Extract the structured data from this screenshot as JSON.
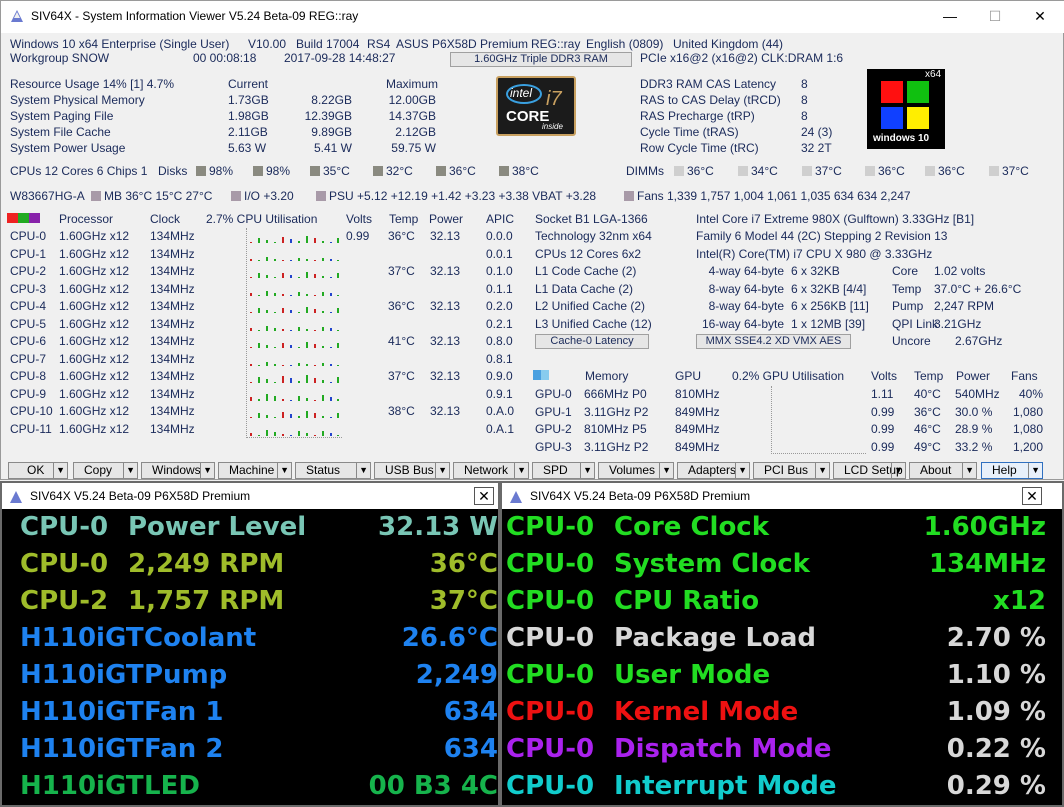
{
  "window": {
    "title": "SIV64X - System Information Viewer V5.24 Beta-09 REG::ray",
    "minimize": "—",
    "maximize": "☐",
    "close": "✕"
  },
  "header": {
    "line1": [
      "Windows 10 x64 Enterprise (Single User)",
      "V10.00",
      "Build 17004",
      "RS4",
      "ASUS P6X58D Premium",
      "REG::ray",
      "English (0809)",
      "United Kingdom (44)"
    ],
    "workgroup": "Workgroup SNOW",
    "uptime": "00 00:08:18",
    "datetime": "2017-09-28 14:48:27",
    "mem_button": "1.60GHz Triple DDR3 RAM",
    "pcie": "PCIe x16@2 (x16@2) CLK:DRAM 1:6"
  },
  "resources": {
    "header": "Resource Usage 14% [1] 4.7%",
    "current_label": "Current",
    "maximum_label": "Maximum",
    "rows": [
      {
        "label": "System Physical Memory",
        "current": "1.73GB",
        "avail": "8.22GB",
        "max": "12.00GB"
      },
      {
        "label": "System Paging File",
        "current": "1.98GB",
        "avail": "12.39GB",
        "max": "14.37GB"
      },
      {
        "label": "System File Cache",
        "current": "2.11GB",
        "avail": "9.89GB",
        "max": "2.12GB"
      },
      {
        "label": "System Power Usage",
        "current": "5.63 W",
        "avail": "5.41 W",
        "max": "59.75 W"
      }
    ]
  },
  "intel_logo": {
    "brand": "intel",
    "core": "CORE",
    "model": "i7",
    "inside": "inside"
  },
  "ram_timing": [
    {
      "label": "DDR3 RAM CAS Latency",
      "value": "8"
    },
    {
      "label": "RAS to CAS Delay (tRCD)",
      "value": "8"
    },
    {
      "label": "RAS Precharge (tRP)",
      "value": "8"
    },
    {
      "label": "Cycle Time (tRAS)",
      "value": "24 (3)"
    },
    {
      "label": "Row Cycle Time (tRC)",
      "value": "32 2T"
    }
  ],
  "win_logo": {
    "bits": "x64",
    "label": "windows 10"
  },
  "cpus_line": {
    "label": "CPUs 12 Cores 6 Chips 1",
    "disks_label": "Disks",
    "disks": [
      "98%",
      "98%",
      "35°C",
      "32°C",
      "36°C",
      "38°C"
    ],
    "dimms_label": "DIMMs",
    "dimms": [
      "36°C",
      "34°C",
      "37°C",
      "36°C",
      "36°C",
      "37°C"
    ]
  },
  "sensor_line": {
    "chip": "W83667HG-A",
    "mb": "MB 36°C 15°C 27°C",
    "io": "I/O +3.20",
    "psu": "PSU +5.12 +12.19 +1.42 +3.23 +3.38 VBAT +3.28",
    "fans": "Fans 1,339 1,757 1,004 1,061 1,035 634 634 2,247"
  },
  "cpu_table": {
    "headers": {
      "processor": "Processor",
      "clock": "Clock",
      "util": "2.7% CPU Utilisation",
      "volts": "Volts",
      "temp": "Temp",
      "power": "Power",
      "apic": "APIC"
    },
    "volts": "0.99",
    "rows": [
      {
        "name": "CPU-0",
        "proc": "1.60GHz x12",
        "clock": "134MHz",
        "temp": "36°C",
        "power": "32.13",
        "apic": "0.0.0",
        "util": 0.6
      },
      {
        "name": "CPU-1",
        "proc": "1.60GHz x12",
        "clock": "134MHz",
        "temp": "",
        "power": "",
        "apic": "0.0.1",
        "util": 0.3
      },
      {
        "name": "CPU-2",
        "proc": "1.60GHz x12",
        "clock": "134MHz",
        "temp": "37°C",
        "power": "32.13",
        "apic": "0.1.0",
        "util": 0.5
      },
      {
        "name": "CPU-3",
        "proc": "1.60GHz x12",
        "clock": "134MHz",
        "temp": "",
        "power": "",
        "apic": "0.1.1",
        "util": 0.4
      },
      {
        "name": "CPU-4",
        "proc": "1.60GHz x12",
        "clock": "134MHz",
        "temp": "36°C",
        "power": "32.13",
        "apic": "0.2.0",
        "util": 0.5
      },
      {
        "name": "CPU-5",
        "proc": "1.60GHz x12",
        "clock": "134MHz",
        "temp": "",
        "power": "",
        "apic": "0.2.1",
        "util": 0.4
      },
      {
        "name": "CPU-6",
        "proc": "1.60GHz x12",
        "clock": "134MHz",
        "temp": "41°C",
        "power": "32.13",
        "apic": "0.8.0",
        "util": 0.5
      },
      {
        "name": "CPU-7",
        "proc": "1.60GHz x12",
        "clock": "134MHz",
        "temp": "",
        "power": "",
        "apic": "0.8.1",
        "util": 0.3
      },
      {
        "name": "CPU-8",
        "proc": "1.60GHz x12",
        "clock": "134MHz",
        "temp": "37°C",
        "power": "32.13",
        "apic": "0.9.0",
        "util": 0.7
      },
      {
        "name": "CPU-9",
        "proc": "1.60GHz x12",
        "clock": "134MHz",
        "temp": "",
        "power": "",
        "apic": "0.9.1",
        "util": 0.6
      },
      {
        "name": "CPU-10",
        "proc": "1.60GHz x12",
        "clock": "134MHz",
        "temp": "38°C",
        "power": "32.13",
        "apic": "0.A.0",
        "util": 0.6
      },
      {
        "name": "CPU-11",
        "proc": "1.60GHz x12",
        "clock": "134MHz",
        "temp": "",
        "power": "",
        "apic": "0.A.1",
        "util": 0.5
      }
    ]
  },
  "socket": {
    "lines": [
      "Socket B1 LGA-1366",
      "Technology 32nm  x64",
      "CPUs 12 Cores 6x2",
      "L1 Code Cache (2)",
      "L1 Data Cache (2)",
      "L2 Unified Cache (2)",
      "L3 Unified Cache (12)"
    ],
    "latency_button": "Cache-0 Latency"
  },
  "cpuinfo": {
    "name": "Intel Core i7 Extreme 980X (Gulftown) 3.33GHz [B1]",
    "family": "Family 6  Model 44 (2C)  Stepping 2  Revision 13",
    "brand": "Intel(R) Core(TM) i7 CPU X 980 @ 3.33GHz",
    "caches": [
      {
        "ways": "4-way 64-byte",
        "size": "6 x 32KB",
        "k": "Core",
        "v": "1.02 volts"
      },
      {
        "ways": "8-way 64-byte",
        "size": "6 x 32KB [4/4]",
        "k": "Temp",
        "v": "37.0°C + 26.6°C"
      },
      {
        "ways": "8-way 64-byte",
        "size": "6 x 256KB [11]",
        "k": "Pump",
        "v": "2,247 RPM"
      },
      {
        "ways": "16-way 64-byte",
        "size": "1 x 12MB [39]",
        "k": "QPI Link",
        "v": "3.21GHz"
      }
    ],
    "features_button": "MMX SSE4.2 XD VMX AES",
    "uncore_k": "Uncore",
    "uncore_v": "2.67GHz"
  },
  "gpu_table": {
    "headers": {
      "memory": "Memory",
      "gpu": "GPU",
      "util": "0.2% GPU Utilisation",
      "volts": "Volts",
      "temp": "Temp",
      "power": "Power",
      "fans": "Fans"
    },
    "rows": [
      {
        "name": "GPU-0",
        "mem": "666MHz P0",
        "gpu": "810MHz",
        "volts": "1.11",
        "temp": "40°C",
        "power": "540MHz",
        "fans": "40%"
      },
      {
        "name": "GPU-1",
        "mem": "3.11GHz P2",
        "gpu": "849MHz",
        "volts": "0.99",
        "temp": "36°C",
        "power": "30.0 %",
        "fans": "1,080"
      },
      {
        "name": "GPU-2",
        "mem": "810MHz P5",
        "gpu": "849MHz",
        "volts": "0.99",
        "temp": "46°C",
        "power": "28.9 %",
        "fans": "1,080"
      },
      {
        "name": "GPU-3",
        "mem": "3.11GHz P2",
        "gpu": "849MHz",
        "volts": "0.99",
        "temp": "49°C",
        "power": "33.2 %",
        "fans": "1,200"
      }
    ]
  },
  "buttons": [
    "OK",
    "Copy",
    "Windows",
    "Machine",
    "Status",
    "USB Bus",
    "Network",
    "SPD",
    "Volumes",
    "Adapters",
    "PCI Bus",
    "LCD Setup",
    "About",
    "Help"
  ],
  "panel_left": {
    "title": "SIV64X V5.24 Beta-09  P6X58D Premium",
    "rows": [
      {
        "a": "CPU-0",
        "b": "Power Level",
        "c": "32.13 W",
        "color": "#79c6b5"
      },
      {
        "a": "CPU-0",
        "b": "2,249 RPM",
        "c": "36°C",
        "color": "#9fbc2a"
      },
      {
        "a": "CPU-2",
        "b": "1,757 RPM",
        "c": "37°C",
        "color": "#9fbc2a"
      },
      {
        "a": "H110iGT",
        "b": "Coolant",
        "c": "26.6°C",
        "color": "#1e82f0"
      },
      {
        "a": "H110iGT",
        "b": "Pump",
        "c": "2,249",
        "color": "#1e82f0"
      },
      {
        "a": "H110iGT",
        "b": "Fan 1",
        "c": "634",
        "color": "#1e82f0"
      },
      {
        "a": "H110iGT",
        "b": "Fan 2",
        "c": "634",
        "color": "#1e82f0"
      },
      {
        "a": "H110iGT",
        "b": "LED",
        "c": "00 B3 4C",
        "color": "#16b34c"
      }
    ]
  },
  "panel_right": {
    "title": "SIV64X V5.24 Beta-09  P6X58D Premium",
    "rows": [
      {
        "a": "CPU-0",
        "b": "Core Clock",
        "c": "1.60GHz",
        "ca": "#22dd22",
        "cb": "#22dd22",
        "cc": "#22dd22"
      },
      {
        "a": "CPU-0",
        "b": "System Clock",
        "c": "134MHz",
        "ca": "#22dd22",
        "cb": "#22dd22",
        "cc": "#22dd22"
      },
      {
        "a": "CPU-0",
        "b": "CPU Ratio",
        "c": "x12",
        "ca": "#22dd22",
        "cb": "#22dd22",
        "cc": "#22dd22"
      },
      {
        "a": "CPU-0",
        "b": "Package Load",
        "c": "2.70 %",
        "ca": "#d8d8d8",
        "cb": "#d8d8d8",
        "cc": "#d8d8d8"
      },
      {
        "a": "CPU-0",
        "b": "User Mode",
        "c": "1.10 %",
        "ca": "#22dd22",
        "cb": "#22dd22",
        "cc": "#d8d8d8"
      },
      {
        "a": "CPU-0",
        "b": "Kernel Mode",
        "c": "1.09 %",
        "ca": "#ee1111",
        "cb": "#ee1111",
        "cc": "#d8d8d8"
      },
      {
        "a": "CPU-0",
        "b": "Dispatch Mode",
        "c": "0.22 %",
        "ca": "#aa22ee",
        "cb": "#aa22ee",
        "cc": "#d8d8d8"
      },
      {
        "a": "CPU-0",
        "b": "Interrupt Mode",
        "c": "0.29 %",
        "ca": "#11cccc",
        "cb": "#11cccc",
        "cc": "#d8d8d8"
      }
    ]
  },
  "colors": {
    "text": "#1a2a5a",
    "lcd_bg": "#000000"
  }
}
